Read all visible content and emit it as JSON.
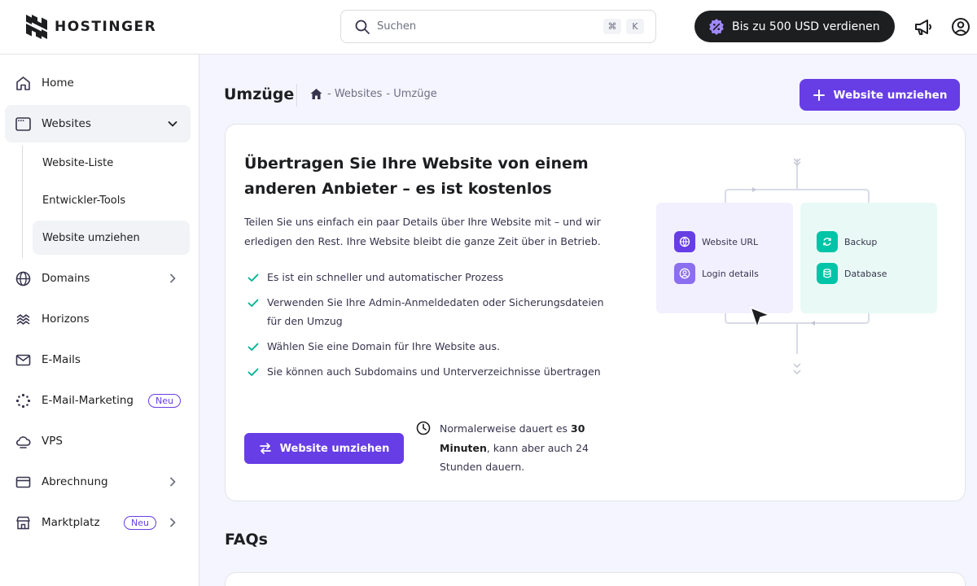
{
  "header": {
    "brand": "HOSTINGER",
    "search": {
      "placeholder": "Suchen",
      "shortcut_cmd": "⌘",
      "shortcut_key": "K"
    },
    "earn_button": "Bis zu 500 USD verdienen",
    "icons": [
      "megaphone-icon",
      "account-icon"
    ]
  },
  "sidebar": {
    "items": [
      {
        "label": "Home",
        "icon": "home-icon"
      },
      {
        "label": "Websites",
        "icon": "browser-window-icon",
        "expanded": true,
        "sub_items": [
          {
            "label": "Website-Liste"
          },
          {
            "label": "Entwickler-Tools"
          },
          {
            "label": "Website umziehen",
            "active": true
          }
        ]
      },
      {
        "label": "Domains",
        "icon": "globe-icon"
      },
      {
        "label": "Horizons",
        "icon": "horizons-icon"
      },
      {
        "label": "E-Mails",
        "icon": "mail-icon"
      },
      {
        "label": "E-Mail-Marketing",
        "icon": "email-marketing-icon",
        "badge": "Neu"
      },
      {
        "label": "VPS",
        "icon": "vps-icon"
      },
      {
        "label": "Abrechnung",
        "icon": "billing-icon"
      },
      {
        "label": "Marktplatz",
        "icon": "store-icon",
        "badge": "Neu"
      }
    ]
  },
  "main": {
    "title": "Umzüge",
    "breadcrumb": [
      "- Websites",
      "- Umzüge"
    ],
    "primary_button": "Website umziehen",
    "card": {
      "title": "Übertragen Sie Ihre Website von einem anderen Anbieter – es ist kostenlos",
      "description": "Teilen Sie uns einfach ein paar Details über Ihre Website mit – und wir erledigen den Rest. Ihre Website bleibt die ganze Zeit über in Betrieb.",
      "checklist": [
        "Es ist ein schneller und automatischer Prozess",
        "Verwenden Sie Ihre Admin-Anmeldedaten oder Sicherungsdateien für den Umzug",
        "Wählen Sie eine Domain für Ihre Website aus.",
        "Sie können auch Subdomains und Unterverzeichnisse übertragen"
      ],
      "button": "Website umziehen",
      "time_note_prefix": "Normalerweise dauert es ",
      "time_note_bold": "30 Minuten",
      "time_note_suffix": ", kann aber auch 24 Stunden dauern.",
      "illustration": {
        "left": [
          "Website URL",
          "Login details"
        ],
        "right": [
          "Backup",
          "Database"
        ]
      }
    },
    "faq_title": "FAQs"
  },
  "colors": {
    "primary": "#673de6",
    "dark": "#1d1e20",
    "check": "#00b090",
    "teal": "#00c4a7"
  }
}
